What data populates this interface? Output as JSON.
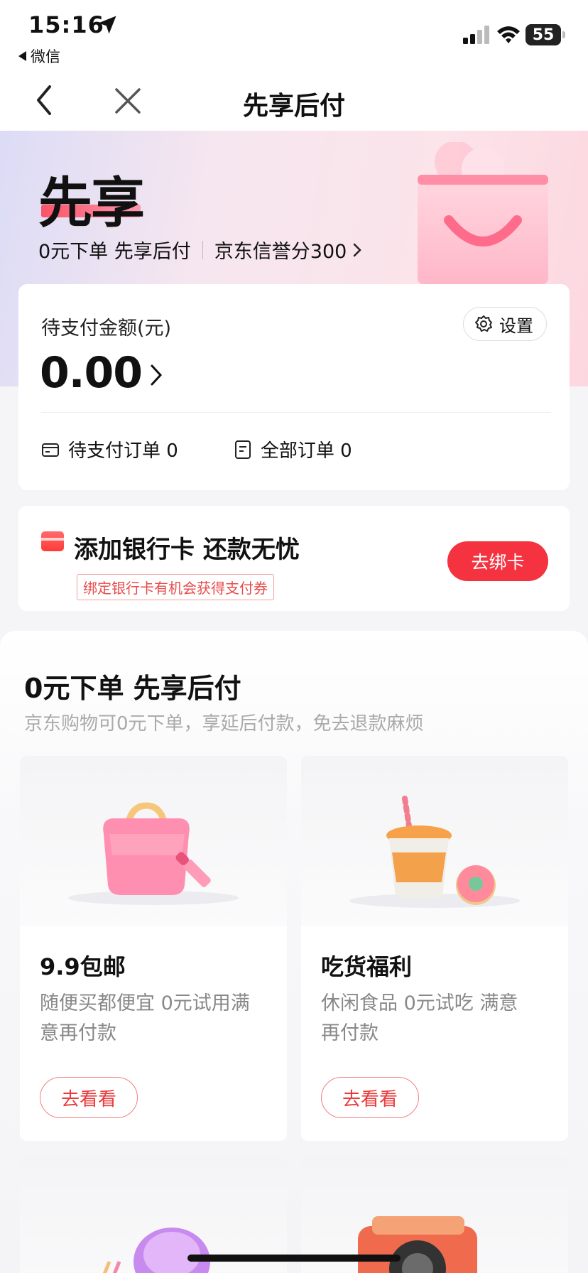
{
  "status_bar": {
    "time": "15:16",
    "back_app": "微信",
    "battery": "55"
  },
  "nav": {
    "title": "先享后付"
  },
  "hero": {
    "title": "先享",
    "subtitle": "0元下单 先享后付",
    "credit": "京东信誉分300"
  },
  "pending": {
    "label": "待支付金额(元)",
    "amount": "0.00",
    "settings": "设置",
    "pending_orders": "待支付订单 0",
    "all_orders": "全部订单 0"
  },
  "bank": {
    "title": "添加银行卡 还款无忧",
    "tag": "绑定银行卡有机会获得支付券",
    "button": "去绑卡"
  },
  "promo": {
    "title": "0元下单 先享后付",
    "subtitle": "京东购物可0元下单，享延后付款，免去退款麻烦",
    "cards": [
      {
        "title": "9.9包邮",
        "desc": "随便买都便宜 0元试用满意再付款",
        "button": "去看看"
      },
      {
        "title": "吃货福利",
        "desc": "休闲食品 0元试吃 满意再付款",
        "button": "去看看"
      }
    ]
  },
  "colors": {
    "accent": "#f5323f",
    "brand_pink": "#ff8aa8"
  }
}
